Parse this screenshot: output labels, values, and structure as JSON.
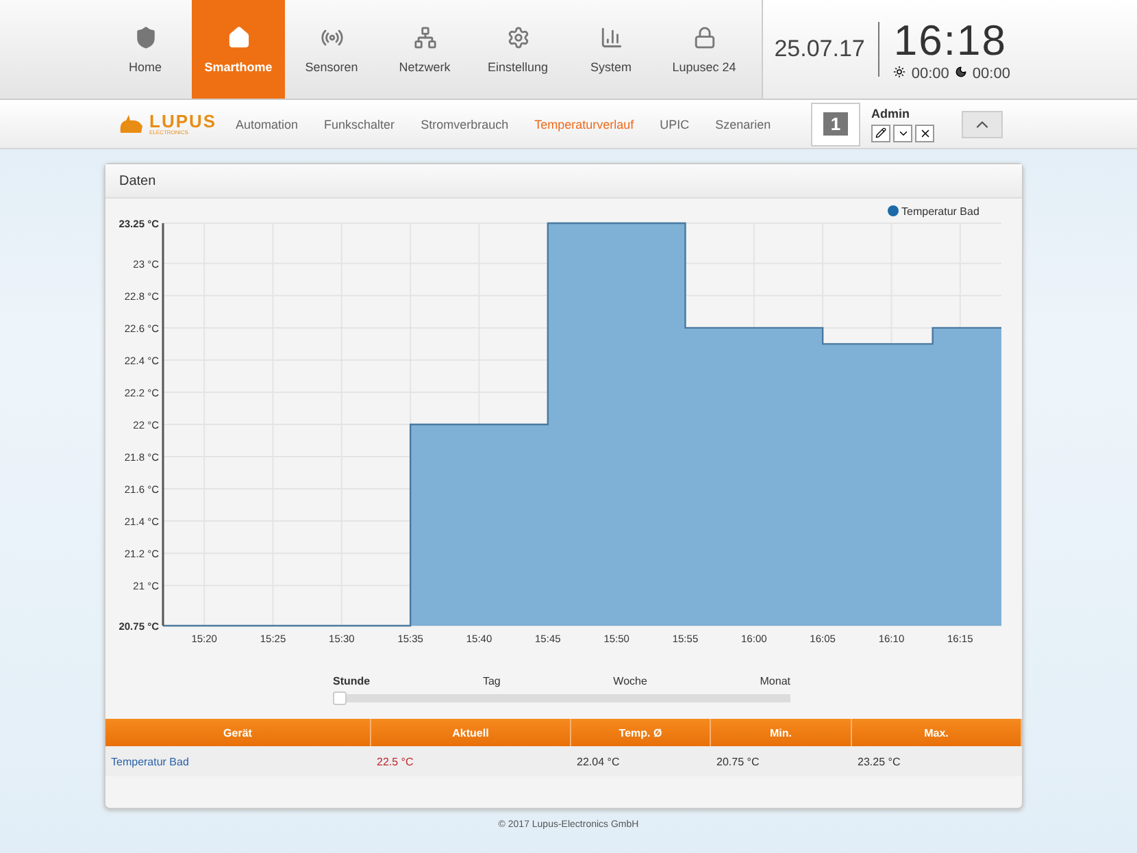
{
  "nav": [
    {
      "label": "Home",
      "selected": false
    },
    {
      "label": "Smarthome",
      "selected": true
    },
    {
      "label": "Sensoren",
      "selected": false
    },
    {
      "label": "Netzwerk",
      "selected": false
    },
    {
      "label": "Einstellung",
      "selected": false
    },
    {
      "label": "System",
      "selected": false
    },
    {
      "label": "Lupusec 24",
      "selected": false
    }
  ],
  "date": "25.07.17",
  "time": "16:18",
  "sunrise": "00:00",
  "sunset": "00:00",
  "logo": {
    "name": "LUPUS",
    "sub": "ELECTRONICS"
  },
  "subnav": [
    {
      "label": "Automation",
      "selected": false
    },
    {
      "label": "Funkschalter",
      "selected": false
    },
    {
      "label": "Stromverbrauch",
      "selected": false
    },
    {
      "label": "Temperaturverlauf",
      "selected": true
    },
    {
      "label": "UPIC",
      "selected": false
    },
    {
      "label": "Szenarien",
      "selected": false
    }
  ],
  "user": {
    "badge": "1",
    "name": "Admin"
  },
  "card": {
    "title": "Daten",
    "chart_data": {
      "type": "area",
      "grid": true,
      "x": [
        917,
        935,
        935,
        945,
        945,
        955,
        955,
        965,
        965,
        973,
        973,
        978
      ],
      "series": [
        {
          "name": "Temperatur Bad",
          "color": "#7fb0d6",
          "values": [
            20.75,
            20.75,
            22,
            22,
            23.25,
            23.25,
            22.6,
            22.6,
            22.5,
            22.5,
            22.6,
            22.6
          ]
        }
      ],
      "xlim": [
        917,
        978
      ],
      "ylim": [
        20.75,
        23.25
      ],
      "yticks": [
        {
          "value": 20.75,
          "label": "20.75 °C"
        },
        {
          "value": 21,
          "label": "21 °C"
        },
        {
          "value": 21.2,
          "label": "21.2 °C"
        },
        {
          "value": 21.4,
          "label": "21.4 °C"
        },
        {
          "value": 21.6,
          "label": "21.6 °C"
        },
        {
          "value": 21.8,
          "label": "21.8 °C"
        },
        {
          "value": 22,
          "label": "22 °C"
        },
        {
          "value": 22.2,
          "label": "22.2 °C"
        },
        {
          "value": 22.4,
          "label": "22.4 °C"
        },
        {
          "value": 22.6,
          "label": "22.6 °C"
        },
        {
          "value": 22.8,
          "label": "22.8 °C"
        },
        {
          "value": 23,
          "label": "23 °C"
        },
        {
          "value": 23.25,
          "label": "23.25 °C"
        }
      ],
      "xticks": [
        {
          "value": 920,
          "label": "15:20"
        },
        {
          "value": 925,
          "label": "15:25"
        },
        {
          "value": 930,
          "label": "15:30"
        },
        {
          "value": 935,
          "label": "15:35"
        },
        {
          "value": 940,
          "label": "15:40"
        },
        {
          "value": 945,
          "label": "15:45"
        },
        {
          "value": 950,
          "label": "15:50"
        },
        {
          "value": 955,
          "label": "15:55"
        },
        {
          "value": 960,
          "label": "16:00"
        },
        {
          "value": 965,
          "label": "16:05"
        },
        {
          "value": 970,
          "label": "16:10"
        },
        {
          "value": 975,
          "label": "16:15"
        }
      ]
    },
    "range": {
      "options": [
        {
          "label": "Stunde",
          "selected": true
        },
        {
          "label": "Tag",
          "selected": false
        },
        {
          "label": "Woche",
          "selected": false
        },
        {
          "label": "Monat",
          "selected": false
        }
      ]
    },
    "table": {
      "columns": [
        "Gerät",
        "Aktuell",
        "Temp. Ø",
        "Min.",
        "Max."
      ],
      "rows": [
        [
          "Temperatur Bad",
          "22.5 °C",
          "22.04 °C",
          "20.75 °C",
          "23.25 °C"
        ]
      ]
    }
  },
  "footer": "© 2017 Lupus-Electronics GmbH"
}
